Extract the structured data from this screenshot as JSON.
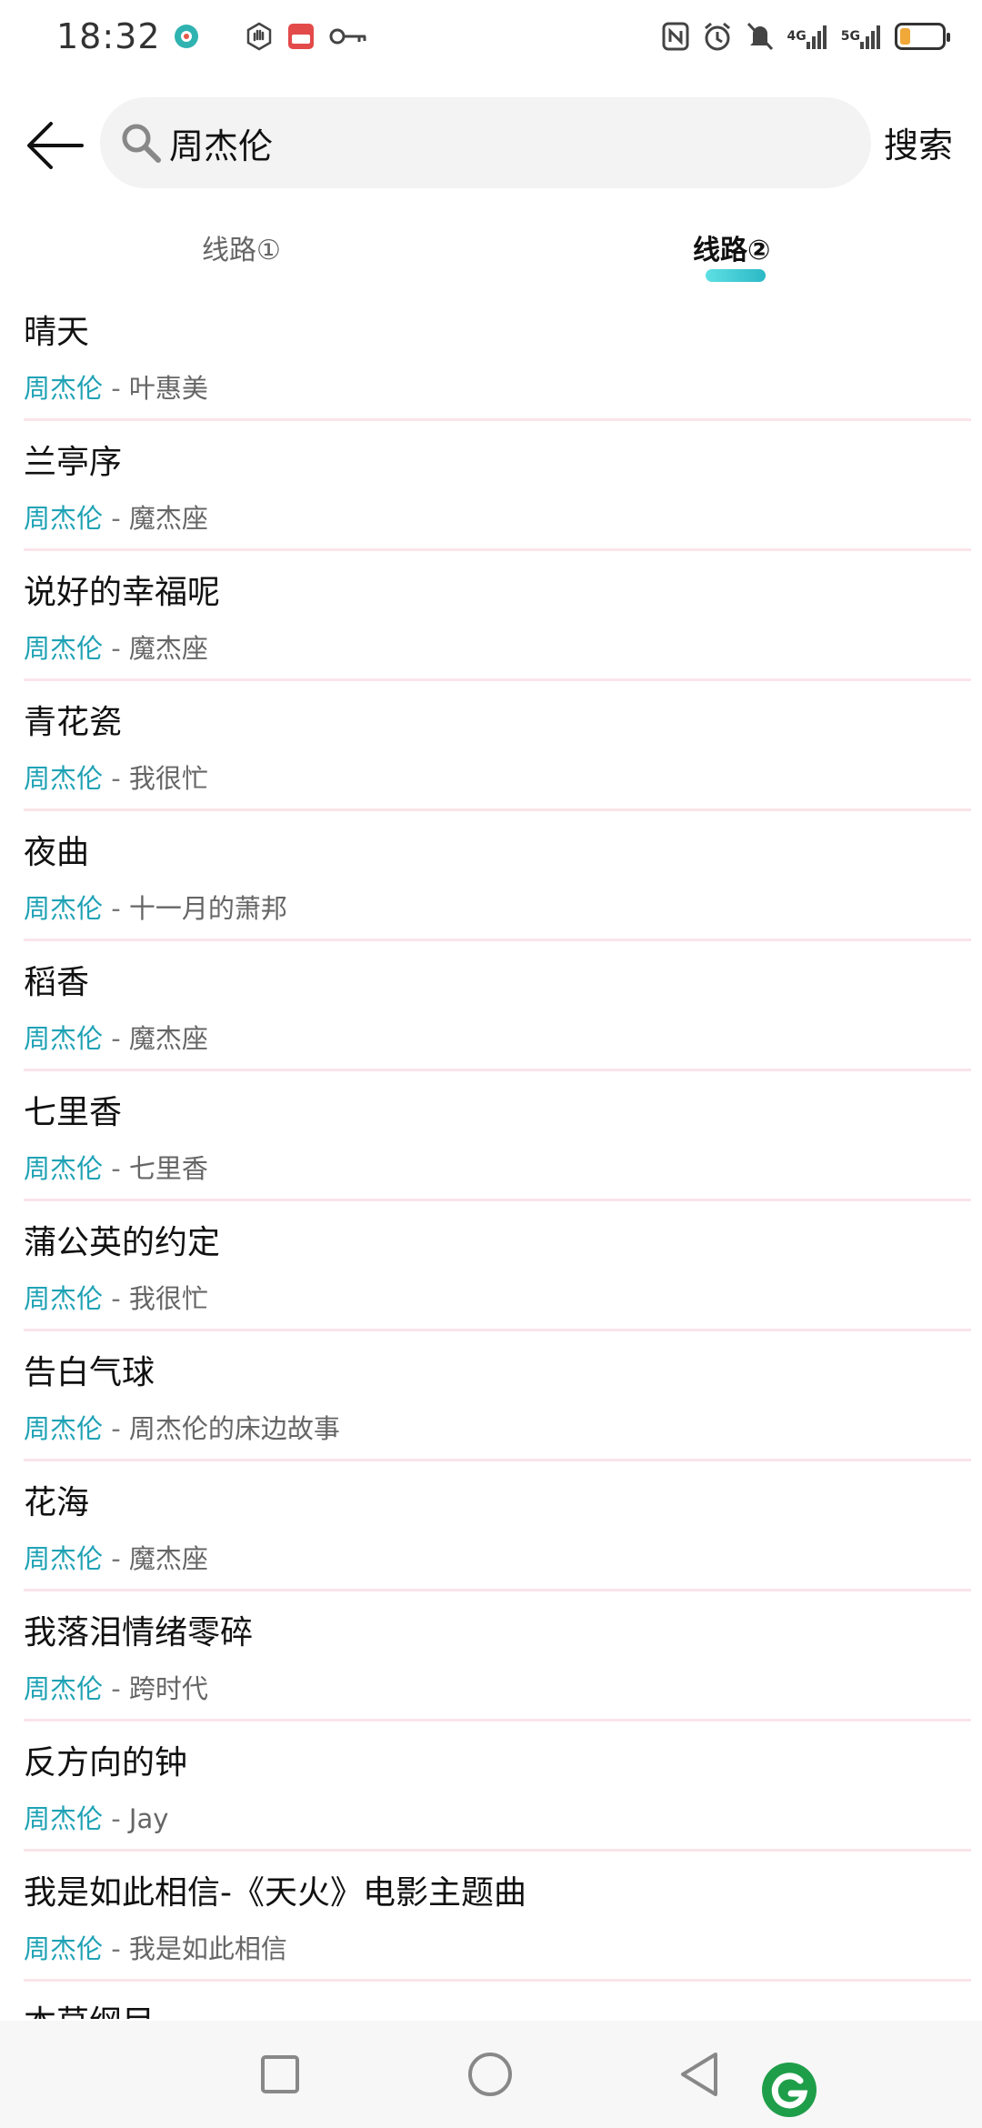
{
  "status_bar": {
    "time": "18:32",
    "network_1": "4G",
    "network_2": "5G",
    "battery_level": 0.25
  },
  "search": {
    "query": "周杰伦",
    "button_label": "搜索"
  },
  "tabs": [
    {
      "label": "线路①",
      "active": false
    },
    {
      "label": "线路②",
      "active": true
    }
  ],
  "songs": [
    {
      "title": "晴天",
      "artist": "周杰伦",
      "album": "叶惠美"
    },
    {
      "title": "兰亭序",
      "artist": "周杰伦",
      "album": "魔杰座"
    },
    {
      "title": "说好的幸福呢",
      "artist": "周杰伦",
      "album": "魔杰座"
    },
    {
      "title": "青花瓷",
      "artist": "周杰伦",
      "album": "我很忙"
    },
    {
      "title": "夜曲",
      "artist": "周杰伦",
      "album": "十一月的萧邦"
    },
    {
      "title": "稻香",
      "artist": "周杰伦",
      "album": "魔杰座"
    },
    {
      "title": "七里香",
      "artist": "周杰伦",
      "album": "七里香"
    },
    {
      "title": "蒲公英的约定",
      "artist": "周杰伦",
      "album": "我很忙"
    },
    {
      "title": "告白气球",
      "artist": "周杰伦",
      "album": "周杰伦的床边故事"
    },
    {
      "title": "花海",
      "artist": "周杰伦",
      "album": "魔杰座"
    },
    {
      "title": "我落泪情绪零碎",
      "artist": "周杰伦",
      "album": "跨时代"
    },
    {
      "title": "反方向的钟",
      "artist": "周杰伦",
      "album": "Jay"
    },
    {
      "title": "我是如此相信-《天火》电影主题曲",
      "artist": "周杰伦",
      "album": "我是如此相信"
    },
    {
      "title": "本草纲目",
      "artist": "",
      "album": ""
    }
  ],
  "separator": " - ",
  "colors": {
    "accent": "#1fa2b5",
    "divider": "#fbe4ea",
    "battery": "#f0a838"
  }
}
